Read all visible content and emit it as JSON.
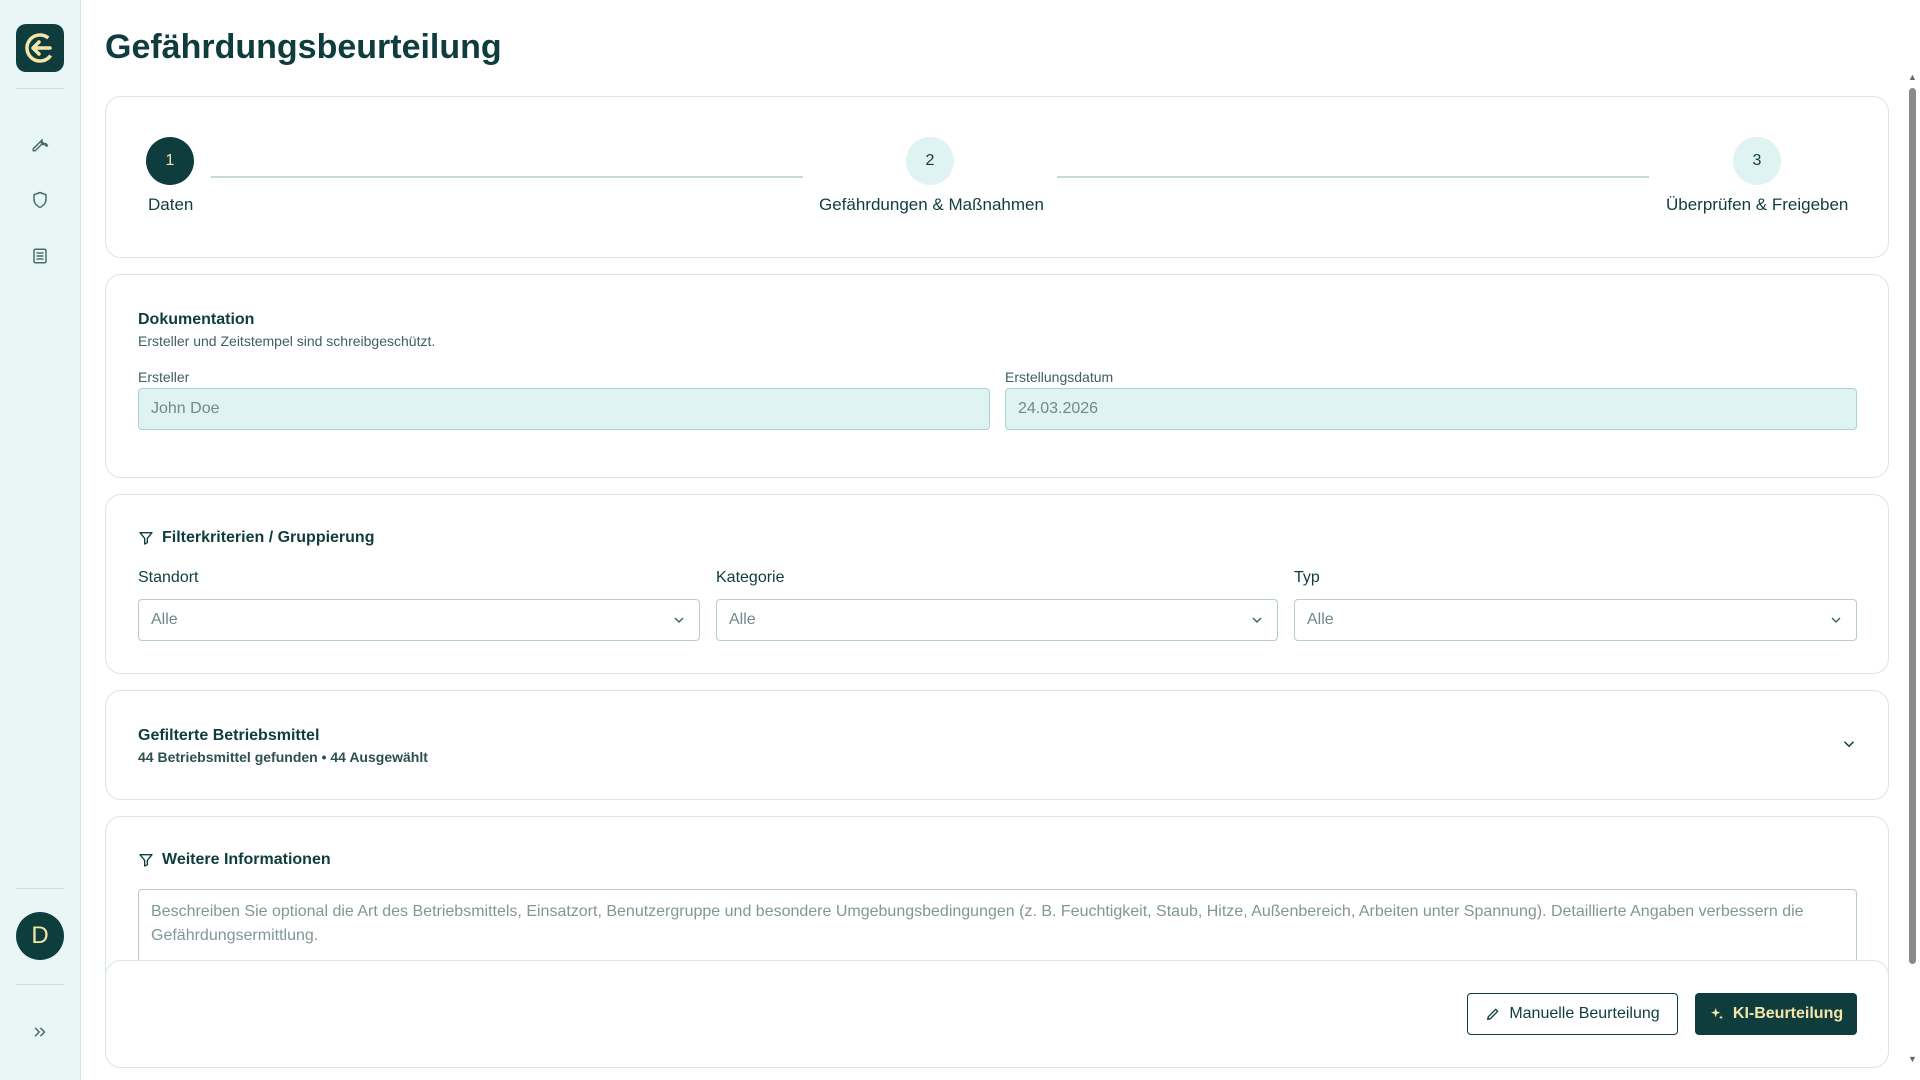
{
  "page": {
    "title": "Gefährdungsbeurteilung"
  },
  "sidebar": {
    "user_initial": "D"
  },
  "stepper": {
    "steps": [
      {
        "number": "1",
        "label": "Daten",
        "state": "active"
      },
      {
        "number": "2",
        "label": "Gefährdungen & Maßnahmen",
        "state": "inactive"
      },
      {
        "number": "3",
        "label": "Überprüfen & Freigeben",
        "state": "inactive"
      }
    ]
  },
  "documentation": {
    "title": "Dokumentation",
    "subtitle": "Ersteller und Zeitstempel sind schreibgeschützt.",
    "creator_label": "Ersteller",
    "creator_value": "John Doe",
    "date_label": "Erstellungsdatum",
    "date_value": "24.03.2026"
  },
  "filters": {
    "title": "Filterkriterien / Gruppierung",
    "location_label": "Standort",
    "location_value": "Alle",
    "category_label": "Kategorie",
    "category_value": "Alle",
    "type_label": "Typ",
    "type_value": "Alle"
  },
  "equipment": {
    "title": "Gefilterte Betriebsmittel",
    "summary": "44 Betriebsmittel gefunden • 44 Ausgewählt"
  },
  "more_info": {
    "title": "Weitere Informationen",
    "placeholder": "Beschreiben Sie optional die Art des Betriebsmittels, Einsatzort, Benutzergruppe und besondere Umgebungsbedingungen (z. B. Feuchtigkeit, Staub, Hitze, Außenbereich, Arbeiten unter Spannung). Detaillierte Angaben verbessern die Gefährdungsermittlung."
  },
  "actions": {
    "manual_label": "Manuelle Beurteilung",
    "ai_label": "KI-Beurteilung"
  },
  "colors": {
    "primary": "#0f3d3e",
    "accent": "#f5e6a8",
    "sidebar_bg": "#e8f6f6",
    "readonly_bg": "#dff3f3"
  }
}
